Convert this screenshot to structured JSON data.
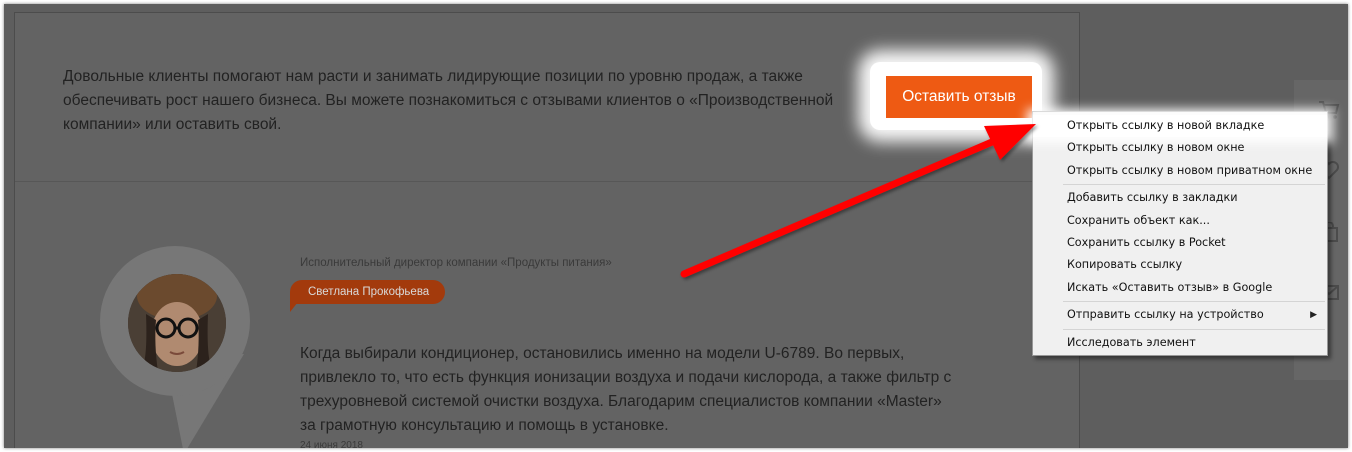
{
  "intro": {
    "line1": "Довольные клиенты помогают нам расти и занимать лидирующие позиции по уровню продаж, а также",
    "line2": "обеспечивать рост нашего бизнеса. Вы можете познакомиться с отзывами клиентов о «Производственной",
    "line3": "компании» или оставить свой."
  },
  "cta": {
    "label": "Оставить отзыв"
  },
  "review": {
    "job_title": "Исполнительный директор компании «Продукты питания»",
    "name": "Светлана Прокофьева",
    "line1": "Когда выбирали кондиционер, остановились именно на модели U-6789. Во первых,",
    "line2": "привлекло то, что есть функция ионизации воздуха и подачи кислорода, а также фильтр с",
    "line3": "трехуровневой системой очистки воздуха. Благодарим специалистов компании «Master»",
    "line4": "за грамотную консультацию и помощь в установке.",
    "date": "24 июня 2018"
  },
  "side_icons": [
    "cart-icon",
    "heart-icon",
    "bag-icon",
    "mail-icon"
  ],
  "context_menu": {
    "items": [
      {
        "label": "Открыть ссылку в новой вкладке"
      },
      {
        "label": "Открыть ссылку в новом окне"
      },
      {
        "label": "Открыть ссылку в новом приватном окне"
      },
      {
        "label": "Добавить ссылку в закладки"
      },
      {
        "label": "Сохранить объект как..."
      },
      {
        "label": "Сохранить ссылку в Pocket"
      },
      {
        "label": "Копировать ссылку"
      },
      {
        "label": "Искать «Оставить отзыв» в Google"
      },
      {
        "label": "Отправить ссылку на устройство"
      },
      {
        "label": "Исследовать элемент"
      }
    ]
  },
  "colors": {
    "overlay": "#5e5e5e",
    "accent": "#ee5a13",
    "badge": "#a33a0c",
    "arrow": "#ff0000",
    "menu_bg": "#f0f0f0"
  }
}
